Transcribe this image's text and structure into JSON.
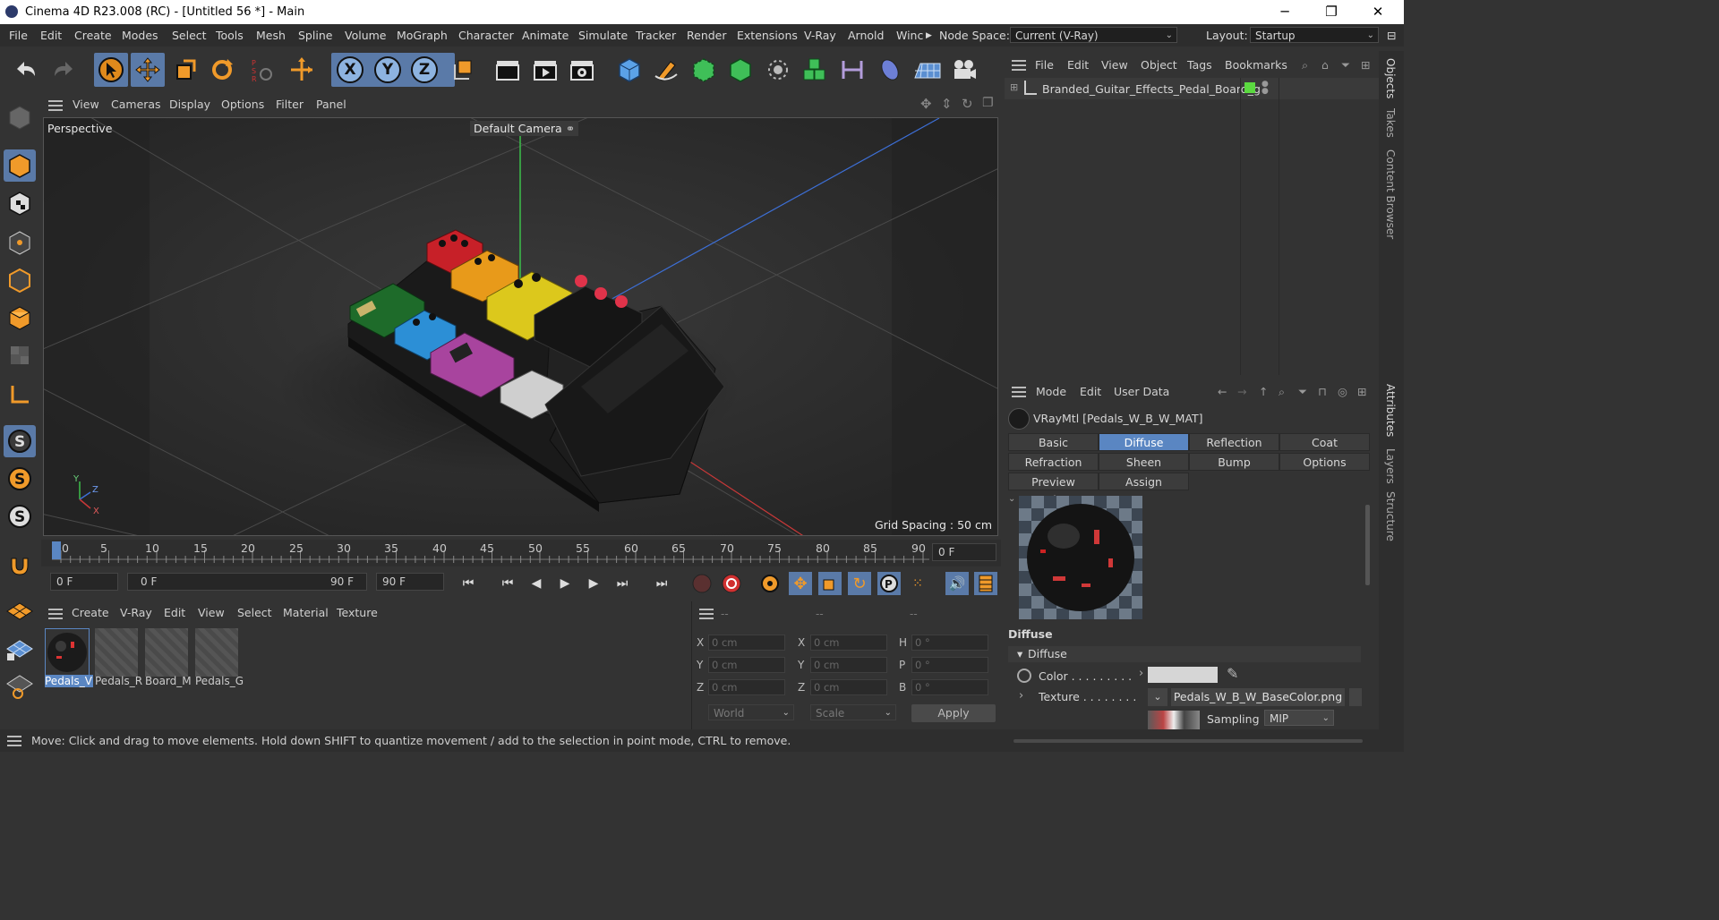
{
  "titlebar": {
    "title": "Cinema 4D R23.008 (RC) - [Untitled 56 *] - Main",
    "minimize": "─",
    "maximize": "❐",
    "close": "✕"
  },
  "menubar": {
    "items": [
      "File",
      "Edit",
      "Create",
      "Modes",
      "Select",
      "Tools",
      "Mesh",
      "Spline",
      "Volume",
      "MoGraph",
      "Character",
      "Animate",
      "Simulate",
      "Tracker",
      "Render",
      "Extensions",
      "V-Ray",
      "Arnold",
      "Winc"
    ],
    "node_space_label": "Node Space:",
    "node_space_value": "Current (V-Ray)",
    "layout_label": "Layout:",
    "layout_value": "Startup"
  },
  "viewport": {
    "menu": [
      "View",
      "Cameras",
      "Display",
      "Options",
      "Filter",
      "Panel"
    ],
    "projection": "Perspective",
    "camera": "Default Camera",
    "grid_spacing": "Grid Spacing : 50 cm",
    "axis_labels": {
      "y": "Y",
      "z": "Z",
      "x": "X"
    }
  },
  "timeline": {
    "ticks": [
      "0",
      "5",
      "10",
      "15",
      "20",
      "25",
      "30",
      "35",
      "40",
      "45",
      "50",
      "55",
      "60",
      "65",
      "70",
      "75",
      "80",
      "85",
      "90"
    ],
    "current_frame_field": "0 F",
    "start_field": "0 F",
    "range_start": "0 F",
    "range_end": "90 F",
    "end_field": "90 F"
  },
  "material_manager": {
    "menu": [
      "Create",
      "V-Ray",
      "Edit",
      "View",
      "Select",
      "Material",
      "Texture"
    ],
    "materials": [
      "Pedals_V",
      "Pedals_R",
      "Board_M",
      "Pedals_G"
    ]
  },
  "coordinates": {
    "headers": [
      "--",
      "--",
      "--"
    ],
    "rows": [
      {
        "l1": "X",
        "v1": "0 cm",
        "l2": "X",
        "v2": "0 cm",
        "l3": "H",
        "v3": "0 °"
      },
      {
        "l1": "Y",
        "v1": "0 cm",
        "l2": "Y",
        "v2": "0 cm",
        "l3": "P",
        "v3": "0 °"
      },
      {
        "l1": "Z",
        "v1": "0 cm",
        "l2": "Z",
        "v2": "0 cm",
        "l3": "B",
        "v3": "0 °"
      }
    ],
    "world": "World",
    "scale": "Scale",
    "apply": "Apply"
  },
  "objects": {
    "menu": [
      "File",
      "Edit",
      "View",
      "Object",
      "Tags",
      "Bookmarks"
    ],
    "object_name": "Branded_Guitar_Effects_Pedal_Board_g"
  },
  "attributes": {
    "menu": [
      "Mode",
      "Edit",
      "User Data"
    ],
    "material_title": "VRayMtl [Pedals_W_B_W_MAT]",
    "tabs_row1": [
      "Basic",
      "Diffuse",
      "Reflection",
      "Coat"
    ],
    "tabs_row2": [
      "Refraction",
      "Sheen",
      "Bump",
      "Options"
    ],
    "tabs_row3": [
      "Preview Settings",
      "Assign"
    ],
    "section_title": "Diffuse",
    "group_label": "Diffuse",
    "color_label": "Color . . . . . . . . .",
    "texture_label": "Texture . . . . . . . .",
    "texture_file": "Pedals_W_B_W_BaseColor.png",
    "sampling_label": "Sampling",
    "sampling_value": "MIP"
  },
  "side_tabs": [
    "Objects",
    "Takes",
    "Content Browser",
    "Attributes",
    "Layers",
    "Structure"
  ],
  "status": "Move: Click and drag to move elements. Hold down SHIFT to quantize movement / add to the selection in point mode, CTRL to remove."
}
